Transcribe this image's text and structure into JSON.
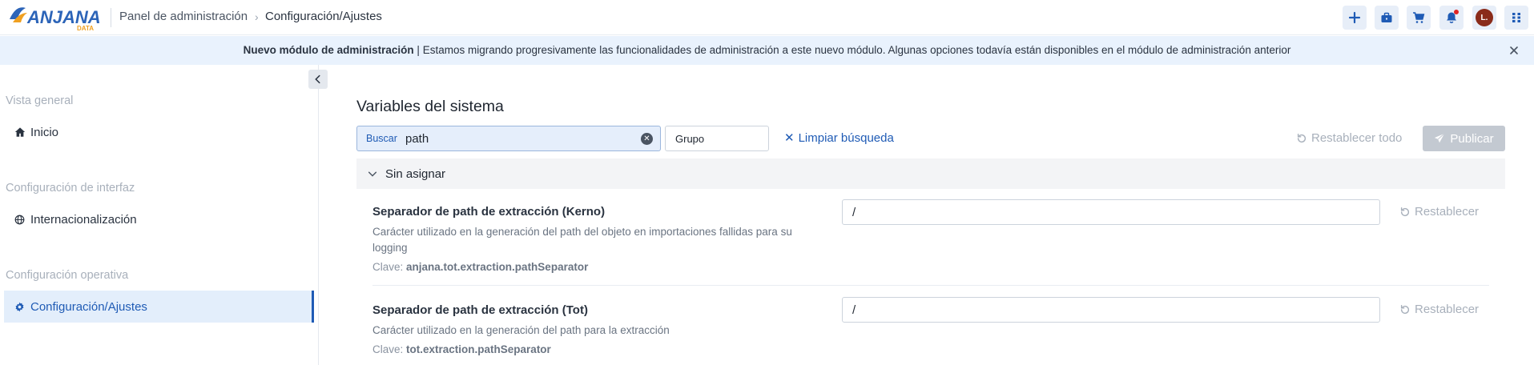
{
  "header": {
    "logo_text": "ANJANA",
    "logo_sub": "DATA",
    "breadcrumb": [
      "Panel de administración",
      "Configuración/Ajustes"
    ],
    "breadcrumb_sep": "›",
    "avatar_initial": "L.",
    "buttons": [
      "plus-icon",
      "briefcase-icon",
      "cart-icon",
      "bell-icon",
      "avatar",
      "apps-grid-icon"
    ]
  },
  "banner": {
    "title": "Nuevo módulo de administración",
    "separator": "|",
    "text": "Estamos migrando progresivamente las funcionalidades de administración a este nuevo módulo. Algunas opciones todavía están disponibles en el  módulo de administración anterior"
  },
  "sidebar": {
    "sections": [
      {
        "title": "Vista general",
        "items": [
          {
            "label": "Inicio",
            "icon": "home-icon",
            "active": false
          }
        ]
      },
      {
        "title": "Configuración de interfaz",
        "items": [
          {
            "label": "Internacionalización",
            "icon": "globe-icon",
            "active": false
          }
        ]
      },
      {
        "title": "Configuración operativa",
        "items": [
          {
            "label": "Configuración/Ajustes",
            "icon": "gear-icon",
            "active": true
          }
        ]
      }
    ]
  },
  "main": {
    "title": "Variables del sistema",
    "search": {
      "label": "Buscar",
      "value": "path"
    },
    "group_filter": {
      "value": "Grupo"
    },
    "clear_search": "Limpiar búsqueda",
    "reset_all": "Restablecer todo",
    "publish": "Publicar",
    "group": {
      "label": "Sin asignar",
      "variables": [
        {
          "name": "Separador de path de extracción (Kerno)",
          "description": "Carácter utilizado en la generación del path del objeto en importaciones fallidas para su logging",
          "key_label": "Clave:",
          "key": "anjana.tot.extraction.pathSeparator",
          "value": "/",
          "reset": "Restablecer"
        },
        {
          "name": "Separador de path de extracción (Tot)",
          "description": "Carácter utilizado en la generación del path para la extracción",
          "key_label": "Clave:",
          "key": "tot.extraction.pathSeparator",
          "value": "/",
          "reset": "Restablecer"
        }
      ]
    }
  },
  "colors": {
    "accent": "#1f5bb5",
    "banner_bg": "#e9f2fd",
    "active_bg": "#e3eefb",
    "disabled": "#c3c9d1",
    "notification": "#e02424"
  }
}
